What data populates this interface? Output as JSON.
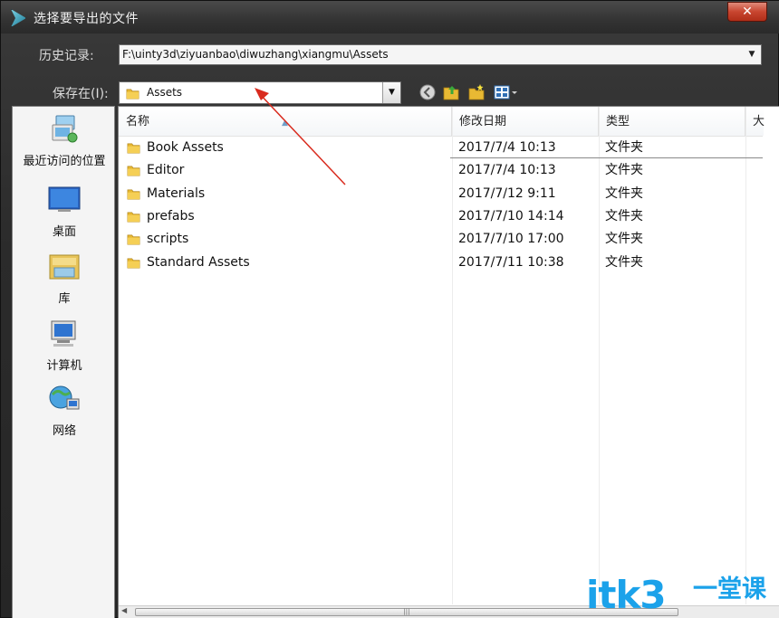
{
  "window": {
    "title": "选择要导出的文件",
    "close_label": "✕"
  },
  "history": {
    "label": "历史记录:",
    "value": "F:\\uinty3d\\ziyuanbao\\diwuzhang\\xiangmu\\Assets"
  },
  "save_in": {
    "label": "保存在(I):",
    "value": "Assets"
  },
  "sidebar": {
    "items": [
      {
        "label": "最近访问的位置",
        "icon": "recent-places-icon"
      },
      {
        "label": "桌面",
        "icon": "desktop-icon"
      },
      {
        "label": "库",
        "icon": "libraries-icon"
      },
      {
        "label": "计算机",
        "icon": "computer-icon"
      },
      {
        "label": "网络",
        "icon": "network-icon"
      }
    ]
  },
  "columns": {
    "name": "名称",
    "date": "修改日期",
    "type": "类型",
    "size": "大"
  },
  "files": [
    {
      "name": "Book Assets",
      "date": "2017/7/4 10:13",
      "type": "文件夹"
    },
    {
      "name": "Editor",
      "date": "2017/7/4 10:13",
      "type": "文件夹"
    },
    {
      "name": "Materials",
      "date": "2017/7/12 9:11",
      "type": "文件夹"
    },
    {
      "name": "prefabs",
      "date": "2017/7/10 14:14",
      "type": "文件夹"
    },
    {
      "name": "scripts",
      "date": "2017/7/10 17:00",
      "type": "文件夹"
    },
    {
      "name": "Standard Assets",
      "date": "2017/7/11 10:38",
      "type": "文件夹"
    }
  ],
  "watermark": {
    "text": "itk3",
    "sub": "一堂课"
  },
  "colors": {
    "annotation_arrow": "#d92b1e",
    "watermark": "#1ba2ea",
    "folder": "#e8b933"
  }
}
